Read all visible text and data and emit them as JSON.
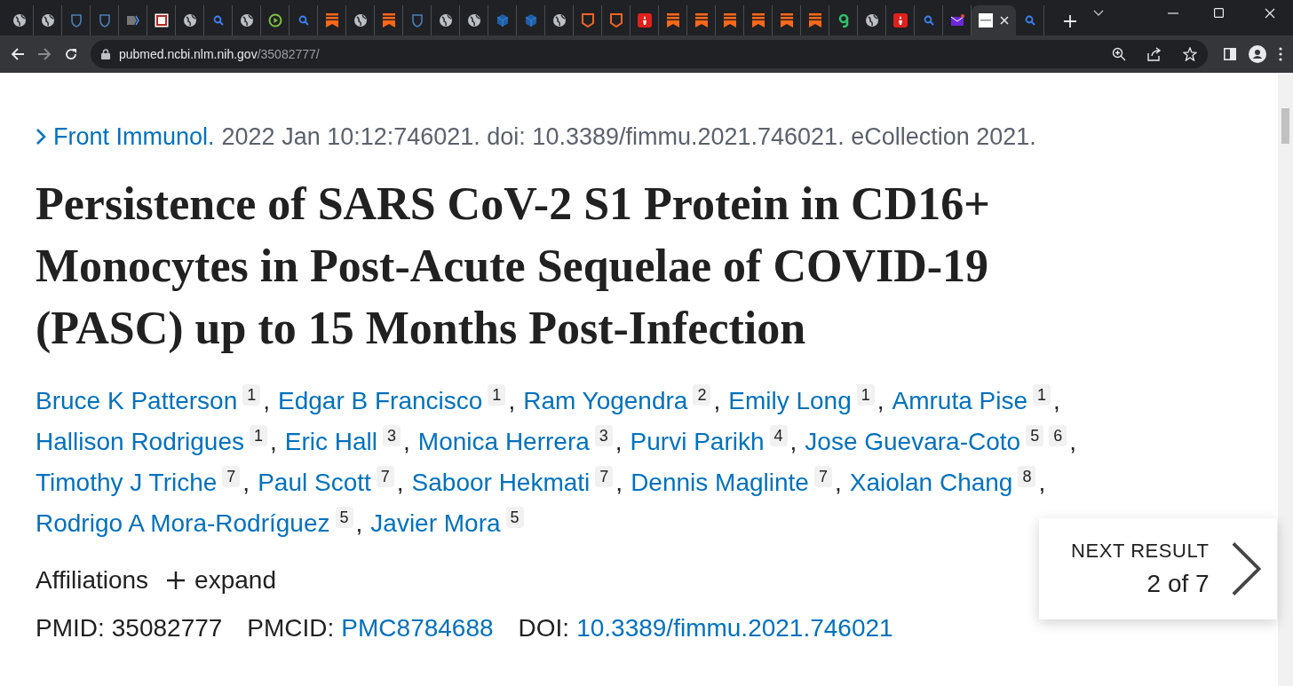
{
  "browser": {
    "tabs": [
      {
        "kind": "globe",
        "selected": false
      },
      {
        "kind": "globe",
        "selected": false
      },
      {
        "kind": "shield",
        "selected": false
      },
      {
        "kind": "shield",
        "selected": false
      },
      {
        "kind": "tag",
        "selected": false
      },
      {
        "kind": "square",
        "selected": false
      },
      {
        "kind": "globe",
        "selected": false
      },
      {
        "kind": "search",
        "selected": false
      },
      {
        "kind": "globe",
        "selected": false
      },
      {
        "kind": "play",
        "selected": false
      },
      {
        "kind": "search",
        "selected": false
      },
      {
        "kind": "bookmark",
        "selected": false
      },
      {
        "kind": "globe",
        "selected": false
      },
      {
        "kind": "bookmark",
        "selected": false
      },
      {
        "kind": "shield",
        "selected": false
      },
      {
        "kind": "globe",
        "selected": false
      },
      {
        "kind": "globe",
        "selected": false
      },
      {
        "kind": "cube",
        "selected": false
      },
      {
        "kind": "cube",
        "selected": false
      },
      {
        "kind": "globe",
        "selected": false
      },
      {
        "kind": "badge",
        "selected": false
      },
      {
        "kind": "badge",
        "selected": false
      },
      {
        "kind": "torch",
        "selected": false
      },
      {
        "kind": "bookmark",
        "selected": false
      },
      {
        "kind": "bookmark",
        "selected": false
      },
      {
        "kind": "bookmark",
        "selected": false
      },
      {
        "kind": "bookmark",
        "selected": false
      },
      {
        "kind": "bookmark",
        "selected": false
      },
      {
        "kind": "bookmark",
        "selected": false
      },
      {
        "kind": "leaf",
        "selected": false
      },
      {
        "kind": "globe",
        "selected": false
      },
      {
        "kind": "torch",
        "selected": false
      },
      {
        "kind": "search",
        "selected": false
      },
      {
        "kind": "mail",
        "selected": false
      },
      {
        "kind": "doc",
        "selected": true
      },
      {
        "kind": "search",
        "selected": false
      }
    ],
    "url_host": "pubmed.ncbi.nlm.nih.gov",
    "url_path": "/35082777/"
  },
  "article": {
    "journal": "Front Immunol.",
    "citation": "2022 Jan 10:12:746021. doi: 10.3389/fimmu.2021.746021. eCollection 2021.",
    "title": "Persistence of SARS CoV-2 S1 Protein in CD16+ Monocytes in Post-Acute Sequelae of COVID-19 (PASC) up to 15 Months Post-Infection",
    "authors": [
      {
        "name": "Bruce K Patterson",
        "affiliations": [
          "1"
        ],
        "sep": ","
      },
      {
        "name": "Edgar B Francisco",
        "affiliations": [
          "1"
        ],
        "sep": ","
      },
      {
        "name": "Ram Yogendra",
        "affiliations": [
          "2"
        ],
        "sep": ","
      },
      {
        "name": "Emily Long",
        "affiliations": [
          "1"
        ],
        "sep": ","
      },
      {
        "name": "Amruta Pise",
        "affiliations": [
          "1"
        ],
        "sep": ","
      },
      {
        "name": "Hallison Rodrigues",
        "affiliations": [
          "1"
        ],
        "sep": ","
      },
      {
        "name": "Eric Hall",
        "affiliations": [
          "3"
        ],
        "sep": ","
      },
      {
        "name": "Monica Herrera",
        "affiliations": [
          "3"
        ],
        "sep": ","
      },
      {
        "name": "Purvi Parikh",
        "affiliations": [
          "4"
        ],
        "sep": ","
      },
      {
        "name": "Jose Guevara-Coto",
        "affiliations": [
          "5",
          "6"
        ],
        "sep": ","
      },
      {
        "name": "Timothy J Triche",
        "affiliations": [
          "7"
        ],
        "sep": ","
      },
      {
        "name": "Paul Scott",
        "affiliations": [
          "7"
        ],
        "sep": ","
      },
      {
        "name": "Saboor Hekmati",
        "affiliations": [
          "7"
        ],
        "sep": ","
      },
      {
        "name": "Dennis Maglinte",
        "affiliations": [
          "7"
        ],
        "sep": ","
      },
      {
        "name": "Xaiolan Chang",
        "affiliations": [
          "8"
        ],
        "sep": ","
      },
      {
        "name": "Rodrigo A Mora-Rodríguez",
        "affiliations": [
          "5"
        ],
        "sep": ","
      },
      {
        "name": "Javier Mora",
        "affiliations": [
          "5"
        ]
      }
    ],
    "affiliations_label": "Affiliations",
    "expand_label": "expand",
    "ids": [
      {
        "label": "PMID:",
        "value": "35082777",
        "link": false
      },
      {
        "label": "PMCID:",
        "value": "PMC8784688",
        "link": true
      },
      {
        "label": "DOI:",
        "value": "10.3389/fimmu.2021.746021",
        "link": true
      }
    ]
  },
  "next_result": {
    "label": "NEXT RESULT",
    "position": "2 of 7"
  }
}
